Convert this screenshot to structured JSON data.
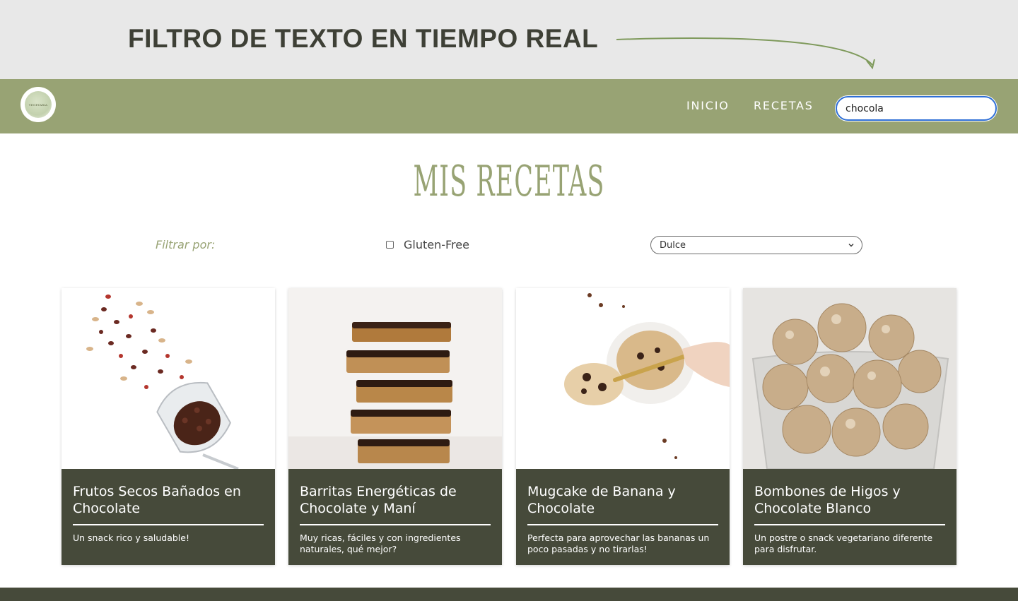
{
  "banner": {
    "title": "FILTRO DE TEXTO EN TIEMPO REAL"
  },
  "navbar": {
    "logo_text": "VEGETARIA",
    "links": [
      {
        "label": "INICIO"
      },
      {
        "label": "RECETAS"
      }
    ],
    "search": {
      "value": "chocola",
      "placeholder": ""
    }
  },
  "main": {
    "title": "MIS RECETAS",
    "filters": {
      "label": "Filtrar por:",
      "gluten_free": {
        "label": "Gluten-Free",
        "checked": false
      },
      "category_select": {
        "selected": "Dulce"
      }
    },
    "recipes": [
      {
        "title": "Frutos Secos Bañados en Chocolate",
        "description": "Un snack rico y saludable!"
      },
      {
        "title": "Barritas Energéticas de Chocolate y Maní",
        "description": "Muy ricas, fáciles y con ingredientes naturales, qué mejor?"
      },
      {
        "title": "Mugcake de Banana y Chocolate",
        "description": "Perfecta para aprovechar las bananas un poco pasadas y no tirarlas!"
      },
      {
        "title": "Bombones de Higos y Chocolate Blanco",
        "description": "Un postre o snack vegetariano diferente para disfrutar."
      }
    ]
  },
  "colors": {
    "accent_green": "#98a374",
    "dark_olive": "#464a3a",
    "banner_gray": "#e8e8e8",
    "focus_blue": "#2f6fd6"
  }
}
